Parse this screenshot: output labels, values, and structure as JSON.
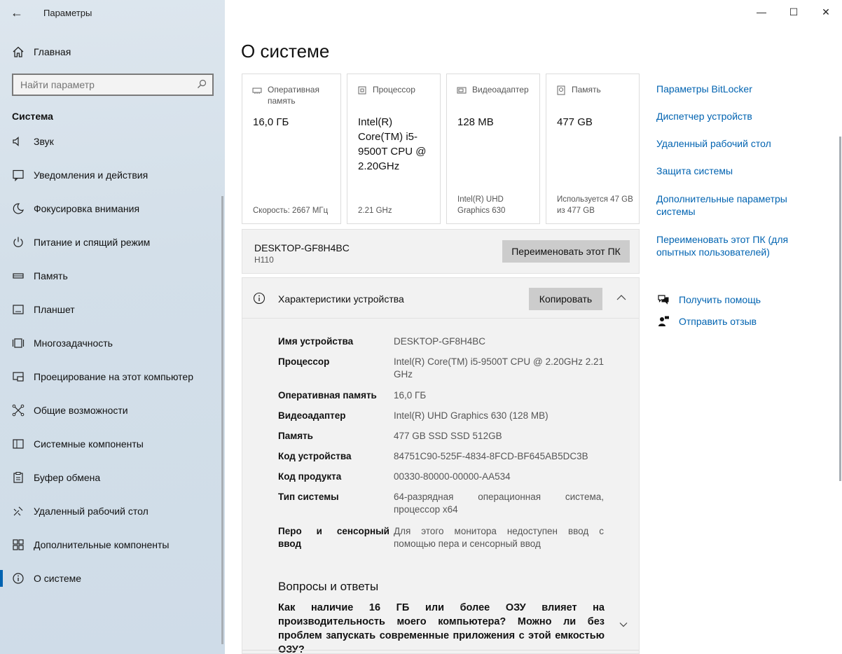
{
  "window": {
    "title": "Параметры",
    "back_glyph": "←",
    "controls": {
      "minimize": "—",
      "maximize": "☐",
      "close": "✕"
    }
  },
  "sidebar": {
    "home_label": "Главная",
    "search_placeholder": "Найти параметр",
    "section_title": "Система",
    "items": [
      {
        "label": "Звук",
        "icon": "sound-icon"
      },
      {
        "label": "Уведомления и действия",
        "icon": "notifications-icon"
      },
      {
        "label": "Фокусировка внимания",
        "icon": "focus-moon-icon"
      },
      {
        "label": "Питание и спящий режим",
        "icon": "power-icon"
      },
      {
        "label": "Память",
        "icon": "storage-icon"
      },
      {
        "label": "Планшет",
        "icon": "tablet-icon"
      },
      {
        "label": "Многозадачность",
        "icon": "multitasking-icon"
      },
      {
        "label": "Проецирование на этот компьютер",
        "icon": "projecting-icon"
      },
      {
        "label": "Общие возможности",
        "icon": "shared-experiences-icon"
      },
      {
        "label": "Системные компоненты",
        "icon": "system-components-icon"
      },
      {
        "label": "Буфер обмена",
        "icon": "clipboard-icon"
      },
      {
        "label": "Удаленный рабочий стол",
        "icon": "remote-desktop-icon"
      },
      {
        "label": "Дополнительные компоненты",
        "icon": "optional-features-icon"
      },
      {
        "label": "О системе",
        "icon": "info-icon",
        "active": true
      }
    ]
  },
  "main": {
    "title": "О системе",
    "cards": [
      {
        "label": "Оперативная память",
        "value": "16,0 ГБ",
        "sub": "Скорость: 2667 МГц",
        "icon": "ram-icon"
      },
      {
        "label": "Процессор",
        "value": "Intel(R) Core(TM) i5-9500T CPU @ 2.20GHz",
        "sub": "2.21 GHz",
        "icon": "cpu-icon"
      },
      {
        "label": "Видеоадаптер",
        "value": "128 MB",
        "sub": "Intel(R) UHD Graphics 630",
        "icon": "gpu-icon"
      },
      {
        "label": "Память",
        "value": "477 GB",
        "sub": "Используется 47 GB из 477 GB",
        "icon": "disk-icon"
      }
    ],
    "pc": {
      "name": "DESKTOP-GF8H4BC",
      "model": "H110",
      "rename_button": "Переименовать этот ПК"
    },
    "specs": {
      "title": "Характеристики устройства",
      "copy_button": "Копировать",
      "rows": [
        {
          "key": "Имя устройства",
          "value": "DESKTOP-GF8H4BC"
        },
        {
          "key": "Процессор",
          "value": "Intel(R) Core(TM) i5-9500T CPU @ 2.20GHz 2.21 GHz"
        },
        {
          "key": "Оперативная память",
          "value": "16,0 ГБ"
        },
        {
          "key": "Видеоадаптер",
          "value": "Intel(R) UHD Graphics 630 (128 MB)"
        },
        {
          "key": "Память",
          "value": "477 GB SSD SSD 512GB"
        },
        {
          "key": "Код устройства",
          "value": "84751C90-525F-4834-8FCD-BF645AB5DC3B"
        },
        {
          "key": "Код продукта",
          "value": "00330-80000-00000-AA534"
        },
        {
          "key": "Тип системы",
          "value": "64-разрядная операционная система, процессор x64"
        },
        {
          "key": "Перо и сенсорный ввод",
          "value": "Для этого монитора недоступен ввод с помощью пера и сенсорный ввод"
        }
      ]
    },
    "faq": {
      "title": "Вопросы и ответы",
      "question": "Как наличие 16 ГБ или более ОЗУ влияет на производительность моего компьютера? Можно ли без проблем запускать современные приложения с этой емкостью ОЗУ?"
    }
  },
  "related": {
    "links": [
      "Параметры BitLocker",
      "Диспетчер устройств",
      "Удаленный рабочий стол",
      "Защита системы",
      "Дополнительные параметры системы",
      "Переименовать этот ПК (для опытных пользователей)"
    ],
    "get_help": "Получить помощь",
    "feedback": "Отправить отзыв"
  }
}
